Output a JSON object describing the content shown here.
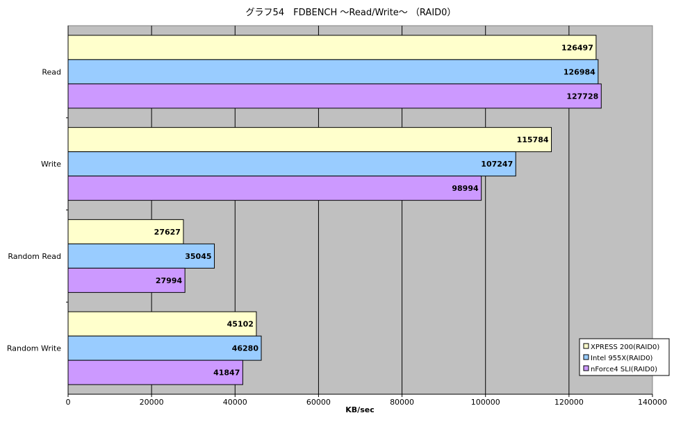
{
  "chart_data": {
    "type": "bar",
    "orientation": "horizontal",
    "title": "グラフ54　FDBENCH ～Read/Write～ （RAID0）",
    "xlabel": "KB/sec",
    "ylabel": "",
    "xlim": [
      0,
      140000
    ],
    "x_ticks": [
      0,
      20000,
      40000,
      60000,
      80000,
      100000,
      120000,
      140000
    ],
    "x_tick_labels": [
      "0",
      "20000",
      "40000",
      "60000",
      "80000",
      "100000",
      "120000",
      "140000"
    ],
    "grid": "vertical",
    "legend_position": "bottom-right",
    "categories": [
      "Read",
      "Write",
      "Random Read",
      "Random Write"
    ],
    "series": [
      {
        "name": "XPRESS 200(RAID0)",
        "color": "#ffffcc",
        "values": [
          126497,
          115784,
          27627,
          45102
        ]
      },
      {
        "name": "Intel 955X(RAID0)",
        "color": "#99ccff",
        "values": [
          126984,
          107247,
          35045,
          46280
        ]
      },
      {
        "name": "nForce4 SLI(RAID0)",
        "color": "#cc99ff",
        "values": [
          127728,
          98994,
          27994,
          41847
        ]
      }
    ],
    "colors": {
      "plot_background": "#c0c0c0",
      "gridline": "#000000",
      "bar_outline": "#000000"
    }
  }
}
